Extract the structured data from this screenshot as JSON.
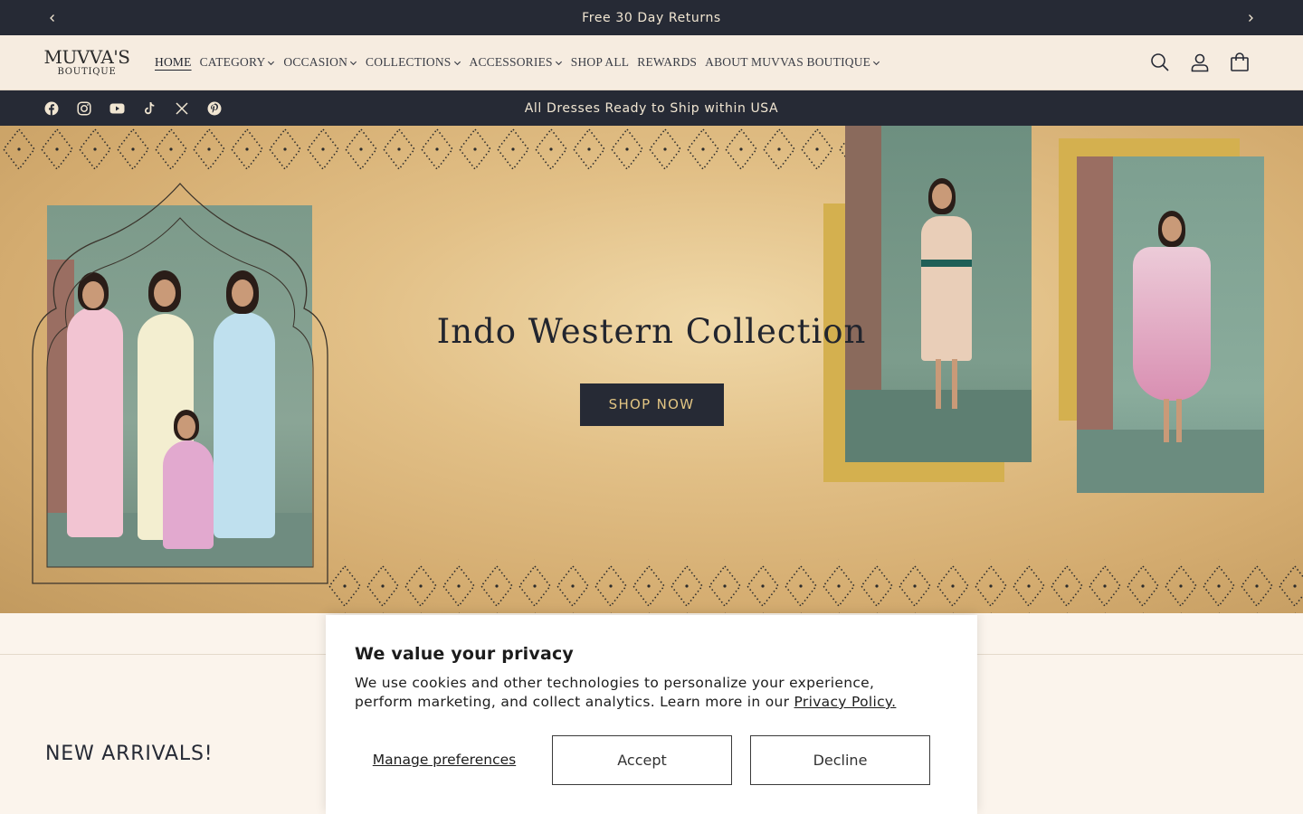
{
  "announcement": {
    "text": "Free 30 Day Returns"
  },
  "logo": {
    "line1": "MUVVA'S",
    "line2": "BOUTIQUE"
  },
  "nav": {
    "items": [
      {
        "label": "HOME",
        "has_dropdown": false,
        "active": true
      },
      {
        "label": "CATEGORY",
        "has_dropdown": true
      },
      {
        "label": "OCCASION",
        "has_dropdown": true
      },
      {
        "label": "COLLECTIONS",
        "has_dropdown": true
      },
      {
        "label": "ACCESSORIES",
        "has_dropdown": true
      },
      {
        "label": "SHOP ALL",
        "has_dropdown": false
      },
      {
        "label": "REWARDS",
        "has_dropdown": false
      },
      {
        "label": "ABOUT MUVVAS BOUTIQUE",
        "has_dropdown": true
      }
    ]
  },
  "header_icons": [
    "search-icon",
    "account-icon",
    "cart-icon"
  ],
  "socials": [
    "facebook-icon",
    "instagram-icon",
    "youtube-icon",
    "tiktok-icon",
    "x-icon",
    "pinterest-icon"
  ],
  "sub_bar": {
    "message": "All Dresses Ready to Ship within USA"
  },
  "hero": {
    "title": "Indo Western Collection",
    "cta": "SHOP NOW"
  },
  "section": {
    "title": "NEW ARRIVALS!"
  },
  "consent": {
    "title": "We value your privacy",
    "body": "We use cookies and other technologies to personalize your experience, perform marketing, and collect analytics. Learn more in our",
    "link": "Privacy Policy.",
    "manage": "Manage preferences",
    "accept": "Accept",
    "decline": "Decline"
  },
  "colors": {
    "dark": "#262a35",
    "cream": "#f6ece0",
    "gold": "#d4b04f",
    "cta_text": "#e2c583"
  }
}
